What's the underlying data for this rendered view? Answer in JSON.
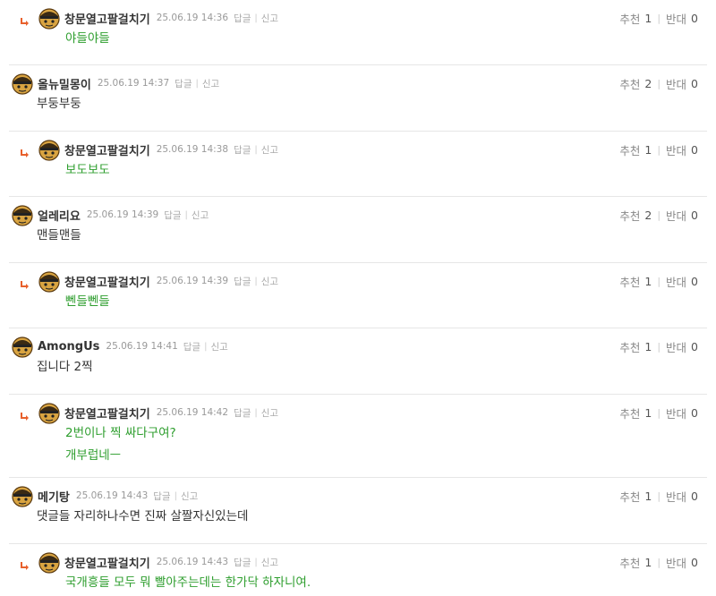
{
  "ui": {
    "reply_label": "답글",
    "report_label": "신고",
    "upvote_label": "추천",
    "downvote_label": "반대"
  },
  "colors": {
    "reply_text": "#2e9e2e",
    "normal_text": "#333333",
    "reply_arrow": "#e8602c"
  },
  "comments": [
    {
      "is_reply": true,
      "nickname": "창문열고팔걸치기",
      "date": "25.06.19 14:36",
      "lines": [
        "야들야들"
      ],
      "up": "1",
      "down": "0"
    },
    {
      "is_reply": false,
      "nickname": "올뉴밀몽이",
      "date": "25.06.19 14:37",
      "lines": [
        "부둥부둥"
      ],
      "up": "2",
      "down": "0"
    },
    {
      "is_reply": true,
      "nickname": "창문열고팔걸치기",
      "date": "25.06.19 14:38",
      "lines": [
        "보도보도"
      ],
      "up": "1",
      "down": "0"
    },
    {
      "is_reply": false,
      "nickname": "얼레리요",
      "date": "25.06.19 14:39",
      "lines": [
        "맨들맨들"
      ],
      "up": "2",
      "down": "0"
    },
    {
      "is_reply": true,
      "nickname": "창문열고팔걸치기",
      "date": "25.06.19 14:39",
      "lines": [
        "뻰들뻰들"
      ],
      "up": "1",
      "down": "0"
    },
    {
      "is_reply": false,
      "nickname": "AmongUs",
      "date": "25.06.19 14:41",
      "lines": [
        "집니다 2찍"
      ],
      "up": "1",
      "down": "0"
    },
    {
      "is_reply": true,
      "nickname": "창문열고팔걸치기",
      "date": "25.06.19 14:42",
      "lines": [
        "2번이나 찍 싸다구여?",
        "개부럽네ㅡ"
      ],
      "up": "1",
      "down": "0"
    },
    {
      "is_reply": false,
      "nickname": "메기탕",
      "date": "25.06.19 14:43",
      "lines": [
        "댓글들 자리하나수면 진짜 살짤자신있는데"
      ],
      "up": "1",
      "down": "0"
    },
    {
      "is_reply": true,
      "nickname": "창문열고팔걸치기",
      "date": "25.06.19 14:43",
      "lines": [
        "국개흥들 모두 뭐 빨아주는데는 한가닥 하자니여."
      ],
      "up": "1",
      "down": "0"
    }
  ]
}
